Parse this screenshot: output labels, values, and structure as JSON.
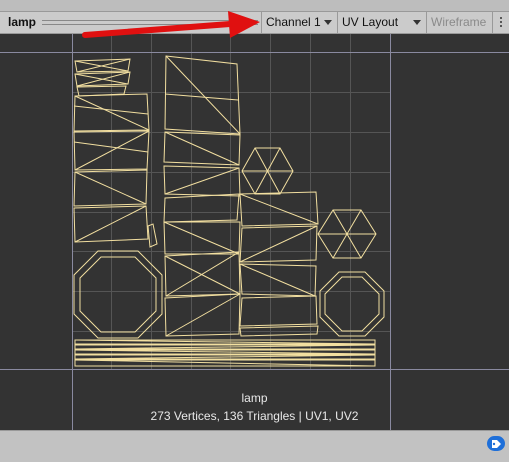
{
  "toolbar": {
    "asset_name": "lamp",
    "channel": "Channel 1",
    "layout": "UV Layout",
    "wireframe": "Wireframe",
    "more_icon": "kebab-menu-icon"
  },
  "preview": {
    "mesh_name": "lamp",
    "stats": "273 Vertices, 136 Triangles | UV1, UV2"
  },
  "colors": {
    "background": "#333333",
    "grid": "#555555",
    "border": "#8a8aa0",
    "uv_lines": "#f2dfa0",
    "annotation_arrow": "#e01010"
  },
  "bottom_bar": {
    "icon": "asset-label-icon"
  }
}
